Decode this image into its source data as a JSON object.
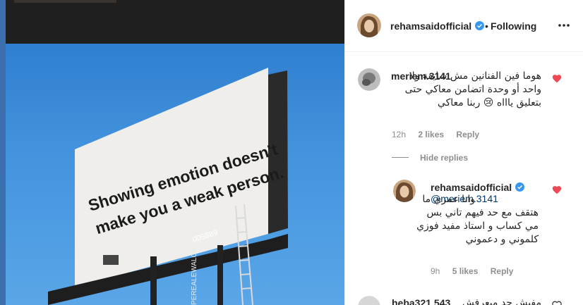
{
  "post": {
    "billboard_text_line1": "Showing emotion doesn't",
    "billboard_text_line2": "make you a weak person.",
    "billboard_code": "005889",
    "billboard_side_text": "PEREALEWALOA"
  },
  "header": {
    "username": "rehamsaidofficial",
    "separator": "•",
    "follow_state": "Following",
    "more_icon": "more-horizontal-icon"
  },
  "comments": [
    {
      "username": "meriem.3141",
      "text": "هوما فين الفنانين مش شايفة ولا واحد أو وحدة اتضامن معاكي حتى بتعليق ياااه 😢 ربنا معاكي",
      "time": "12h",
      "likes": "2 likes",
      "reply": "Reply"
    }
  ],
  "hide_replies": "Hide replies",
  "reply": {
    "username": "rehamsaidofficial",
    "mention": "@meriem.3141",
    "text": "وانا عمري ما هتقف مع حد فيهم تاني بس مي كساب و استاذ مفيد فوزي كلموني و دعموني",
    "time": "9h",
    "likes": "5 likes",
    "reply": "Reply"
  },
  "next_comment": {
    "username": "heba321 543",
    "text": "مفيش حد ميعرفش"
  },
  "colors": {
    "verified": "#3897f0",
    "heart": "#ed4956",
    "muted": "#8e8e8e",
    "sky": "#4494de"
  }
}
